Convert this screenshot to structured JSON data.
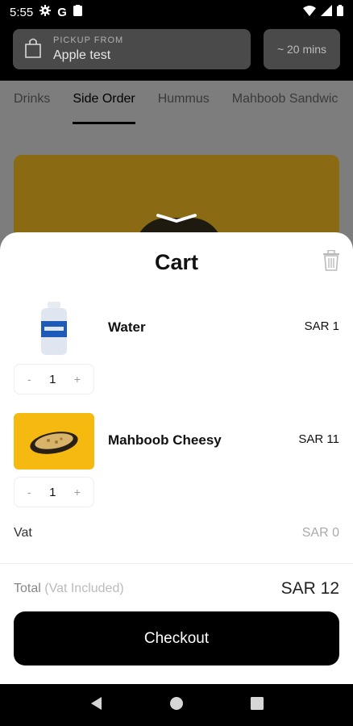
{
  "status_bar": {
    "time": "5:55"
  },
  "header": {
    "pickup_label": "PICKUP FROM",
    "pickup_location": "Apple test",
    "eta": "~ 20 mins"
  },
  "tabs": [
    "Drinks",
    "Side Order",
    "Hummus",
    "Mahboob Sandwic"
  ],
  "active_tab": "Side Order",
  "cart": {
    "title": "Cart",
    "items": [
      {
        "name": "Water",
        "price": "SAR 1",
        "quantity": "1",
        "minus": "-",
        "plus": "+",
        "image": "water-bottle"
      },
      {
        "name": "Mahboob Cheesy",
        "price": "SAR 11",
        "quantity": "1",
        "minus": "-",
        "plus": "+",
        "image": "cheesy-dish"
      }
    ],
    "vat_label": "Vat",
    "vat_value": "SAR 0",
    "total_label": "Total",
    "total_note": "(Vat Included)",
    "total_value": "SAR 12",
    "checkout_label": "Checkout"
  },
  "colors": {
    "accent": "#000000",
    "hero_bg": "#f5b90f"
  },
  "icons": [
    "settings-icon",
    "google-icon",
    "clipboard-icon",
    "wifi-icon",
    "signal-icon",
    "battery-icon",
    "bag-icon",
    "trash-icon",
    "back-icon",
    "home-icon",
    "recents-icon"
  ]
}
